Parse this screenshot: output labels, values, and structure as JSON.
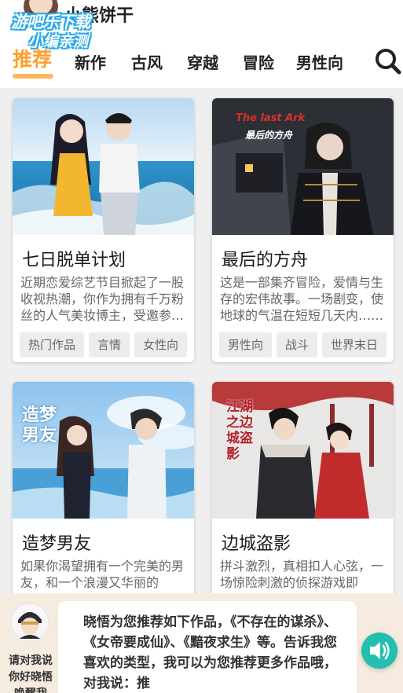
{
  "app": {
    "title": "小熊饼干",
    "watermark_line1": "游吧乐下载",
    "watermark_line2": "小编亲测"
  },
  "tabs": [
    {
      "label": "推荐",
      "active": true
    },
    {
      "label": "新作",
      "active": false
    },
    {
      "label": "古风",
      "active": false
    },
    {
      "label": "穿越",
      "active": false
    },
    {
      "label": "冒险",
      "active": false
    },
    {
      "label": "男性向",
      "active": false
    }
  ],
  "cards": [
    {
      "title": "七日脱单计划",
      "desc": "近期恋爱综艺节目掀起了一股收视热潮，你作为拥有千万粉丝的人气美妆博主，受邀参加……",
      "tags": [
        "热门作品",
        "言情",
        "女性向"
      ]
    },
    {
      "title": "最后的方舟",
      "cover_caption_en": "The last Ark",
      "cover_caption_cn": "最后的方舟",
      "desc": "这是一部集齐冒险，爱情与生存的宏伟故事。一场剧变，使地球的气温在短短几天内……",
      "tags": [
        "男性向",
        "战斗",
        "世界末日"
      ]
    },
    {
      "title": "造梦男友",
      "cover_caption_cn": "造梦男友",
      "desc": "如果你渴望拥有一个完美的男友，和一个浪漫又华丽的"
    },
    {
      "title": "边城盗影",
      "cover_caption_cn": "江湖之边城盗影",
      "desc": "拼斗激烈，真相扣人心弦，一场惊险刺激的侦探游戏即"
    }
  ],
  "assistant": {
    "hint": "请对我说你好晓悟唤醒我",
    "message": "晓悟为您推荐如下作品，《不存在的谋杀》、《女帝要成仙》、《黯夜求生》等。告诉我您喜欢的类型，我可以为您推荐更多作品哦，对我说：推"
  },
  "colors": {
    "accent": "#ff9f2e",
    "underline": "#ffb65c",
    "voice_button": "#23bfae",
    "assistant_bg": "#f5ebdf"
  },
  "icons": {
    "search": "search-icon",
    "voice": "speaker-icon"
  }
}
